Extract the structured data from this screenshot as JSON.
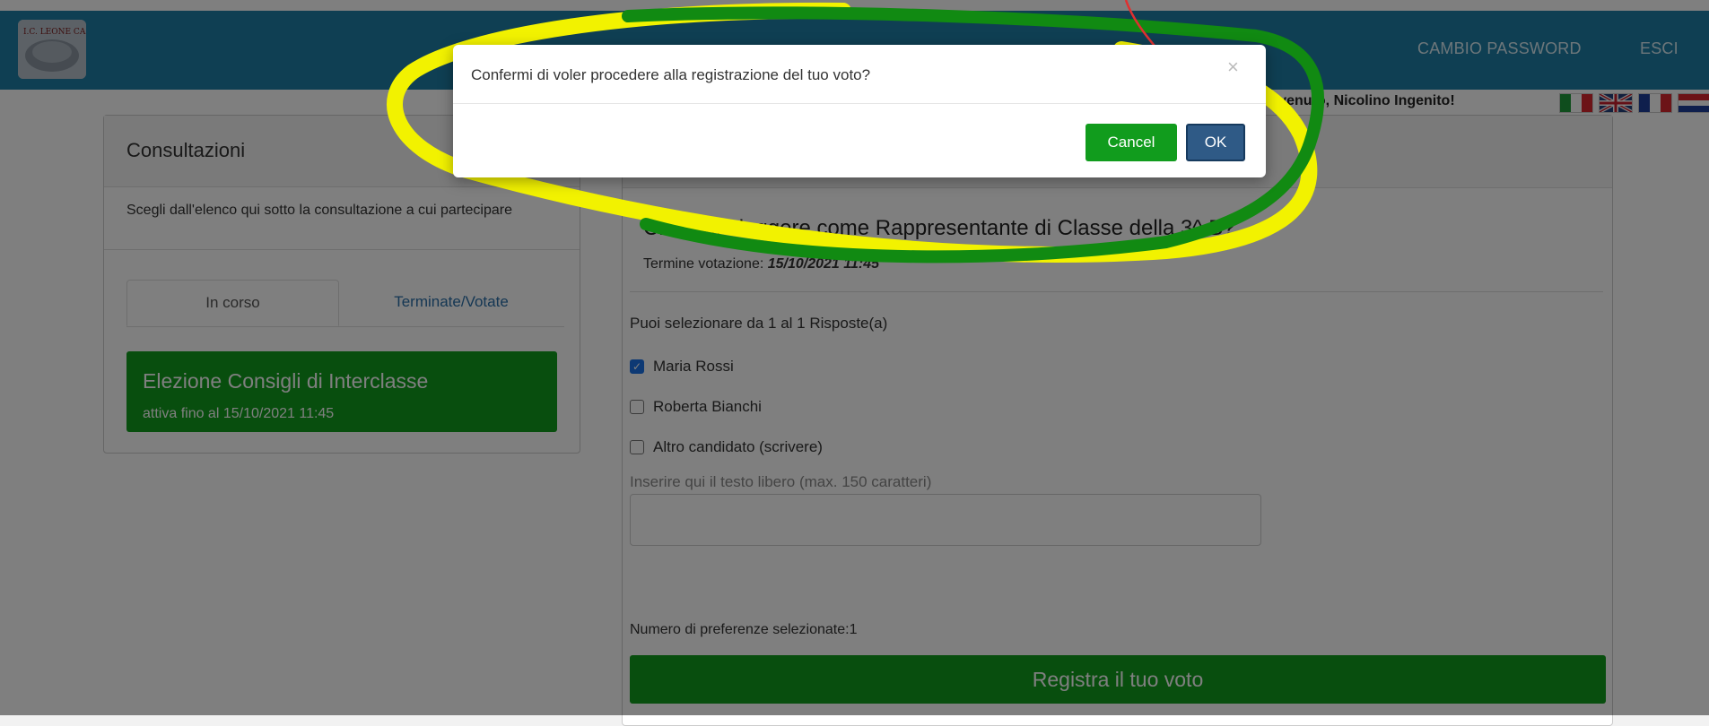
{
  "navbar": {
    "logo_text": "I.C. LEONE CASTORIO",
    "change_password": "CAMBIO PASSWORD",
    "logout": "ESCI"
  },
  "welcome": "Benvenuto,  Nicolino Ingenito!",
  "left": {
    "title": "Consultazioni",
    "description": "Scegli dall'elenco qui sotto la consultazione a cui partecipare",
    "tabs": [
      {
        "label": "In corso",
        "active": true
      },
      {
        "label": "Terminate/Votate",
        "active": false
      }
    ],
    "consultation": {
      "title": "Elezione Consigli di Interclasse",
      "subtitle": "attiva fino al 15/10/2021 11:45"
    }
  },
  "right": {
    "question": "Chi vuoi eleggere come Rappresentante di Classe della 3^ B?",
    "deadline_label": "Termine votazione:",
    "deadline_value": "15/10/2021 11:45",
    "select_info": "Puoi selezionare da 1 al 1 Risposte(a)",
    "options": [
      {
        "label": "Maria Rossi",
        "checked": true
      },
      {
        "label": "Roberta Bianchi",
        "checked": false
      },
      {
        "label": "Altro candidato (scrivere)",
        "checked": false
      }
    ],
    "free_text_label": "Inserire qui il testo libero (max. 150 caratteri)",
    "free_text_value": "",
    "count_text": "Numero di preferenze selezionate:1",
    "submit_label": "Registra il tuo voto"
  },
  "modal": {
    "message": "Confermi di voler procedere alla registrazione del tuo voto?",
    "close_symbol": "×",
    "cancel_label": "Cancel",
    "ok_label": "OK"
  },
  "colors": {
    "navbar": "#1f7fa6",
    "green": "#119c1d",
    "ok": "#2f5a86",
    "annotation_yellow": "#f2f200",
    "annotation_green": "#118a12",
    "annotation_red": "#e03030"
  }
}
